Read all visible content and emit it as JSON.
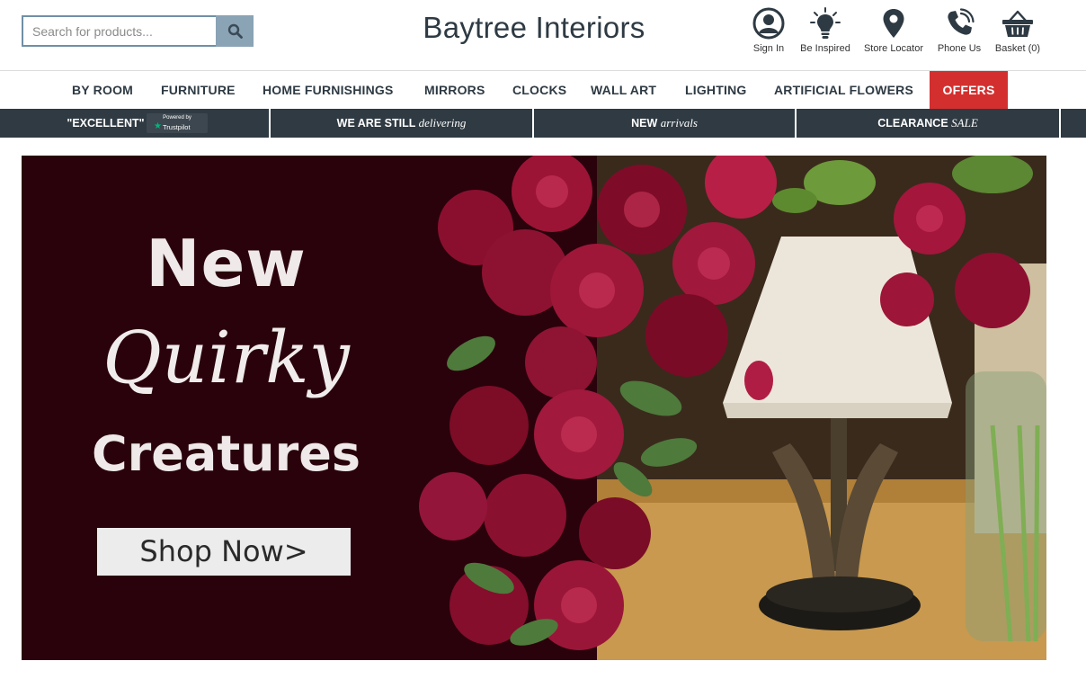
{
  "header": {
    "search": {
      "placeholder": "Search for products...",
      "value": ""
    },
    "logo": "Baytree Interiors",
    "icons": [
      {
        "name": "user-icon",
        "label": "Sign In"
      },
      {
        "name": "lightbulb-icon",
        "label": "Be Inspired"
      },
      {
        "name": "map-pin-icon",
        "label": "Store Locator"
      },
      {
        "name": "phone-icon",
        "label": "Phone Us"
      },
      {
        "name": "basket-icon",
        "label": "Basket (0)"
      }
    ]
  },
  "nav": {
    "items": [
      "BY ROOM",
      "FURNITURE",
      "HOME FURNISHINGS",
      "MIRRORS",
      "CLOCKS",
      "WALL ART",
      "LIGHTING",
      "ARTIFICIAL FLOWERS",
      "OFFERS"
    ]
  },
  "promo": {
    "trustpilot": {
      "rating": "\"EXCELLENT\"",
      "powered": "Powered by",
      "brand": "Trustpilot"
    },
    "delivering": {
      "bold": "WE ARE STILL",
      "italic": "delivering"
    },
    "arrivals": {
      "bold": "NEW",
      "italic": "arrivals"
    },
    "clearance": {
      "bold": "CLEARANCE",
      "italic": "SALE"
    }
  },
  "banner": {
    "line1": "New",
    "line2": "Quirky",
    "line3": "Creatures",
    "cta": "Shop Now>"
  },
  "colors": {
    "offers_bg": "#d42f2f",
    "promo_bar": "#2f3a42",
    "banner_bg": "#2a020c",
    "trustpilot_star": "#00b67a"
  }
}
